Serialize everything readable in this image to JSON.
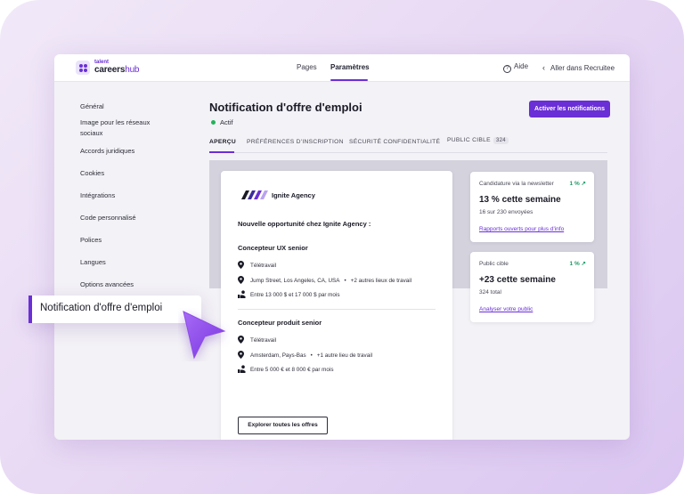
{
  "brand": {
    "line1": "talent",
    "line2_a": "careers",
    "line2_b": "hub",
    "accent": "#6a2fd6"
  },
  "topnav": {
    "pages": "Pages",
    "settings": "Paramètres",
    "help": "Aide",
    "help_icon": "question-circle-icon",
    "recruit": "Aller dans Recruitee",
    "recruit_icon": "chevron-left-icon"
  },
  "sidebar": {
    "items": [
      "Général",
      "Image pour les réseaux sociaux",
      "Accords juridiques",
      "Cookies",
      "Intégrations",
      "Code personnalisé",
      "Polices",
      "Langues",
      "Options avancées"
    ]
  },
  "callout": {
    "label": "Notification d'offre d'emploi"
  },
  "main": {
    "title": "Notification d'offre d'emploi",
    "status": "Actif",
    "status_color": "#21b35a",
    "activate_button": "Activer les notifications",
    "tabs": [
      {
        "label": "APERÇU"
      },
      {
        "label": "PRÉFÉRENCES D'INSCRIPTION"
      },
      {
        "label": "SÉCURITÉ CONFIDENTIALITÉ"
      },
      {
        "label": "PUBLIC CIBLE",
        "badge": "324"
      }
    ]
  },
  "email": {
    "agency": "Ignite Agency",
    "intro": "Nouvelle opportunité chez Ignite Agency :",
    "jobs": [
      {
        "title": "Concepteur UX senior",
        "remote": "Télétravail",
        "location": "Jump Street, Los Angeles, CA, USA",
        "location_more": "+2 autres lieux de travail",
        "salary": "Entre 13 000 $ et 17 000 $ par mois"
      },
      {
        "title": "Concepteur produit senior",
        "remote": "Télétravail",
        "location": "Amsterdam, Pays-Bas",
        "location_more": "+1 autre lieu de travail",
        "salary": "Entre 5 000 € et 8 000 € par mois"
      }
    ],
    "explore_button": "Explorer toutes les offres"
  },
  "stats": [
    {
      "label": "Candidature via la newsletter",
      "pct": "1 %",
      "value": "13 % cette semaine",
      "sub": "16 sur 230 envoyées",
      "link": "Rapports ouverts pour plus d'info"
    },
    {
      "label": "Public cible",
      "pct": "1 %",
      "value": "+23 cette semaine",
      "sub": "324 total",
      "link": "Analyser votre public"
    }
  ]
}
